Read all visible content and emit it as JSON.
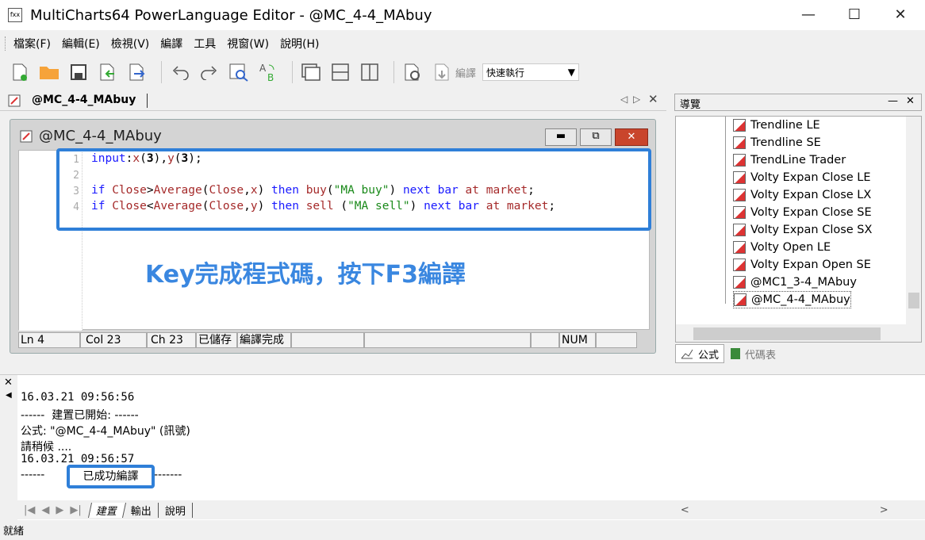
{
  "window": {
    "title": "MultiCharts64 PowerLanguage Editor - @MC_4-4_MAbuy",
    "app_icon_text": "fxx"
  },
  "menu": [
    "檔案(F)",
    "編輯(E)",
    "檢視(V)",
    "編譯",
    "工具",
    "視窗(W)",
    "說明(H)"
  ],
  "toolbar": {
    "compile_label": "編譯",
    "run_select": "快速執行"
  },
  "doc_tab": {
    "label": "@MC_4-4_MAbuy"
  },
  "editor": {
    "title": "@MC_4-4_MAbuy",
    "line_numbers": [
      "1",
      "2",
      "3",
      "4"
    ],
    "annotation": "Key完成程式碼，按下F3編譯",
    "status": {
      "ln": "Ln 4",
      "col": "Col 23",
      "ch": "Ch 23",
      "saved": "已儲存",
      "compiled": "編譯完成",
      "num": "NUM"
    }
  },
  "navigator": {
    "title": "導覽",
    "items": [
      "Trendline LE",
      "Trendline SE",
      "TrendLine Trader",
      "Volty Expan Close LE",
      "Volty Expan Close LX",
      "Volty Expan Close SE",
      "Volty Expan Close SX",
      "Volty Open LE",
      "Volty Expan Open SE",
      "@MC1_3-4_MAbuy",
      "@MC_4-4_MAbuy"
    ],
    "tabs": [
      "公式",
      "代碼表"
    ]
  },
  "output": {
    "lines": [
      "16.03.21 09:56:56",
      "------  建置已開始: ------",
      "公式: \"@MC_4-4_MAbuy\" (訊號)",
      "請稍候 ....",
      "16.03.21 09:56:57",
      "------",
      "-------"
    ],
    "success": "已成功編譯",
    "tabs": [
      "建置",
      "輸出",
      "說明"
    ]
  },
  "statusbar": {
    "text": "就緒"
  },
  "colors": {
    "highlight": "#2f7fd8",
    "annotation": "#3a87e0",
    "keyword": "#1a1aff",
    "function": "#a52a2a",
    "string": "#1a8a1a"
  }
}
